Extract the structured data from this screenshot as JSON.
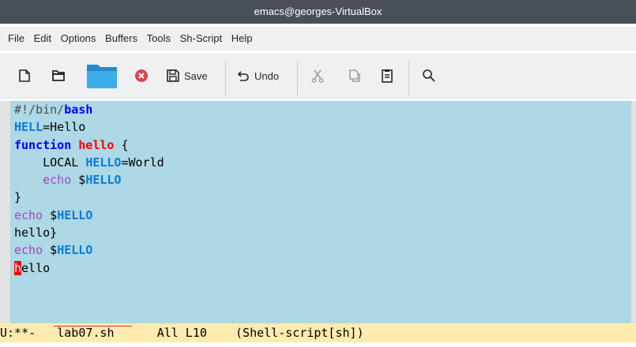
{
  "window": {
    "title": "emacs@georges-VirtualBox"
  },
  "menu": [
    "File",
    "Edit",
    "Options",
    "Buffers",
    "Tools",
    "Sh-Script",
    "Help"
  ],
  "toolbar": {
    "save_label": "Save",
    "undo_label": "Undo"
  },
  "editor": {
    "lines": [
      [
        {
          "t": "#!/bin/",
          "c": "cmt"
        },
        {
          "t": "bash",
          "c": "k"
        }
      ],
      [
        {
          "t": "HELL",
          "c": "v"
        },
        {
          "t": "=Hello",
          "c": ""
        }
      ],
      [
        {
          "t": "function",
          "c": "k"
        },
        {
          "t": " ",
          "c": ""
        },
        {
          "t": "hello",
          "c": "fn"
        },
        {
          "t": " {",
          "c": ""
        }
      ],
      [
        {
          "t": "    LOCAL ",
          "c": ""
        },
        {
          "t": "HELLO",
          "c": "v"
        },
        {
          "t": "=World",
          "c": ""
        }
      ],
      [
        {
          "t": "    ",
          "c": ""
        },
        {
          "t": "echo",
          "c": "b"
        },
        {
          "t": " $",
          "c": ""
        },
        {
          "t": "HELLO",
          "c": "vb"
        }
      ],
      [
        {
          "t": "}",
          "c": ""
        }
      ],
      [
        {
          "t": "echo",
          "c": "b"
        },
        {
          "t": " $",
          "c": ""
        },
        {
          "t": "HELLO",
          "c": "vb"
        }
      ],
      [
        {
          "t": "hello}",
          "c": ""
        }
      ],
      [
        {
          "t": "echo",
          "c": "b"
        },
        {
          "t": " $",
          "c": ""
        },
        {
          "t": "HELLO",
          "c": "vb"
        }
      ],
      [
        {
          "t": "h",
          "c": "cursor"
        },
        {
          "t": "ello",
          "c": ""
        }
      ]
    ]
  },
  "modeline": {
    "status": "U:**-",
    "buffer": "lab07.sh",
    "position": "All L10",
    "mode": "(Shell-script[sh])"
  }
}
